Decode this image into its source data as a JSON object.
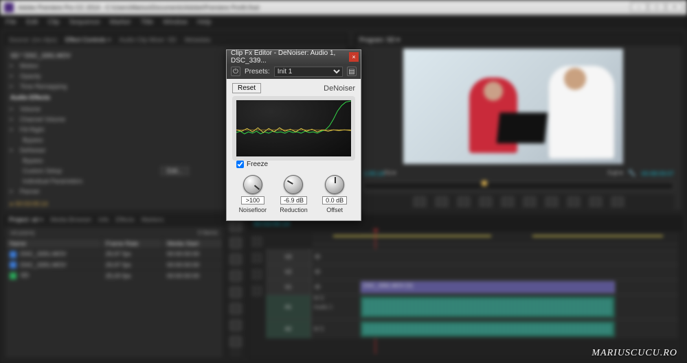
{
  "app": {
    "title": "Adobe Premiere Pro CC 2014 - C:\\Users\\Marius\\Documents\\Adobe\\Premiere Pro\\8.0\\sd",
    "menus": [
      "File",
      "Edit",
      "Clip",
      "Sequence",
      "Marker",
      "Title",
      "Window",
      "Help"
    ]
  },
  "effect_controls": {
    "tabs": [
      "Source: (no clips)",
      "Effect Controls ×",
      "Audio Clip Mixer: SD",
      "Metadata"
    ],
    "clip": "SD * DSC_3391.MOV",
    "rows": [
      "Motion",
      "Opacity",
      "Time Remapping"
    ],
    "audio_section": "Audio Effects",
    "audio_rows": [
      "Volume",
      "Channel Volume",
      "Fill Right",
      "Bypass",
      "DeNoiser",
      "Bypass",
      "Custom Setup",
      "Individual Parameters",
      "Panner"
    ],
    "edit_btn": "Edit...",
    "seq_tc": "▸ 00:03:05:14"
  },
  "program": {
    "tab": "Program: SD ▾",
    "tc_left": "1:05:14",
    "fit": "Fit ▾",
    "full": "Full ▾",
    "tc_right": "00:08:09:07"
  },
  "project": {
    "tabs": [
      "Project: sd ×",
      "Media Browser",
      "Info",
      "Effects",
      "Markers"
    ],
    "sub": "sd.prproj",
    "count": "3 Items",
    "cols": [
      "Name",
      "Frame Rate",
      "Media Start"
    ],
    "items": [
      {
        "color": "#3b7ad6",
        "name": "DSC_3391.MOV",
        "fr": "29,97 fps",
        "ms": "00:00:00:00"
      },
      {
        "color": "#3b7ad6",
        "name": "DSC_3391.MOV",
        "fr": "29,97 fps",
        "ms": "00:00:00:00"
      },
      {
        "color": "#2aa85a",
        "name": "SD",
        "fr": "25,00 fps",
        "ms": "00:00:00:00"
      }
    ]
  },
  "timeline": {
    "tc": "00:03:05:14",
    "tracks": {
      "v3": "V3",
      "v2": "V2",
      "v1": "V1",
      "a1": "A1",
      "a2": "A2"
    },
    "audio_label": "Audio 1",
    "clip_v": "DSC_3391.MOV [V]"
  },
  "fx": {
    "title": "Clip Fx Editor - DeNoiser: Audio 1, DSC_339...",
    "presets_label": "Presets:",
    "preset": "Init 1",
    "reset": "Reset",
    "brand": "DeNoiser",
    "freeze": "Freeze",
    "knobs": [
      {
        "val": ">100",
        "lab": "Noisefloor"
      },
      {
        "val": "-6.9 dB",
        "lab": "Reduction"
      },
      {
        "val": "0.0 dB",
        "lab": "Offset"
      }
    ]
  },
  "watermark": "MARIUSCUCU.RO"
}
